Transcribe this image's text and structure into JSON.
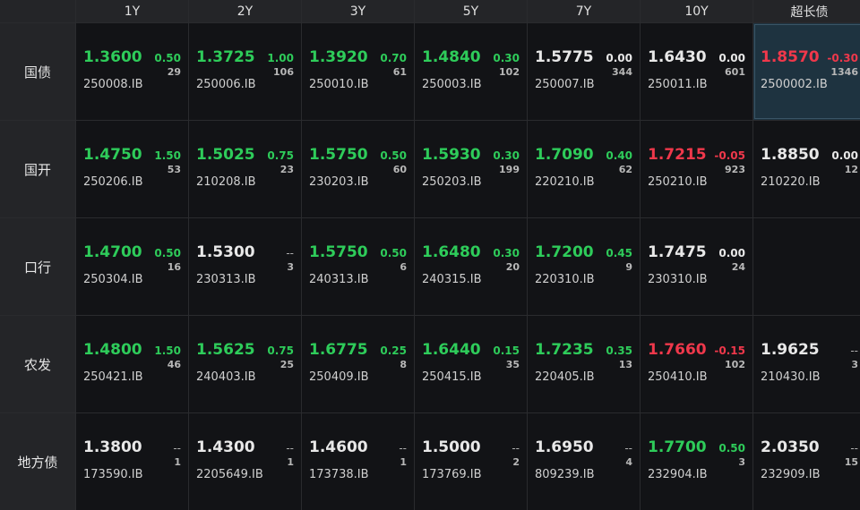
{
  "columns": [
    "1Y",
    "2Y",
    "3Y",
    "5Y",
    "7Y",
    "10Y",
    "超长债"
  ],
  "rows": [
    {
      "label": "国债",
      "cells": [
        {
          "yield": "1.3600",
          "change": "0.50",
          "volume": "29",
          "code": "250008.IB",
          "dir": "up"
        },
        {
          "yield": "1.3725",
          "change": "1.00",
          "volume": "106",
          "code": "250006.IB",
          "dir": "up"
        },
        {
          "yield": "1.3920",
          "change": "0.70",
          "volume": "61",
          "code": "250010.IB",
          "dir": "up"
        },
        {
          "yield": "1.4840",
          "change": "0.30",
          "volume": "102",
          "code": "250003.IB",
          "dir": "up"
        },
        {
          "yield": "1.5775",
          "change": "0.00",
          "volume": "344",
          "code": "250007.IB",
          "dir": "flat"
        },
        {
          "yield": "1.6430",
          "change": "0.00",
          "volume": "601",
          "code": "250011.IB",
          "dir": "flat"
        },
        {
          "yield": "1.8570",
          "change": "-0.30",
          "volume": "1346",
          "code": "2500002.IB",
          "dir": "down",
          "selected": true
        }
      ]
    },
    {
      "label": "国开",
      "cells": [
        {
          "yield": "1.4750",
          "change": "1.50",
          "volume": "53",
          "code": "250206.IB",
          "dir": "up"
        },
        {
          "yield": "1.5025",
          "change": "0.75",
          "volume": "23",
          "code": "210208.IB",
          "dir": "up"
        },
        {
          "yield": "1.5750",
          "change": "0.50",
          "volume": "60",
          "code": "230203.IB",
          "dir": "up"
        },
        {
          "yield": "1.5930",
          "change": "0.30",
          "volume": "199",
          "code": "250203.IB",
          "dir": "up"
        },
        {
          "yield": "1.7090",
          "change": "0.40",
          "volume": "62",
          "code": "220210.IB",
          "dir": "up"
        },
        {
          "yield": "1.7215",
          "change": "-0.05",
          "volume": "923",
          "code": "250210.IB",
          "dir": "down"
        },
        {
          "yield": "1.8850",
          "change": "0.00",
          "volume": "12",
          "code": "210220.IB",
          "dir": "flat"
        }
      ]
    },
    {
      "label": "口行",
      "cells": [
        {
          "yield": "1.4700",
          "change": "0.50",
          "volume": "16",
          "code": "250304.IB",
          "dir": "up"
        },
        {
          "yield": "1.5300",
          "change": "--",
          "volume": "3",
          "code": "230313.IB",
          "dir": "none"
        },
        {
          "yield": "1.5750",
          "change": "0.50",
          "volume": "6",
          "code": "240313.IB",
          "dir": "up"
        },
        {
          "yield": "1.6480",
          "change": "0.30",
          "volume": "20",
          "code": "240315.IB",
          "dir": "up"
        },
        {
          "yield": "1.7200",
          "change": "0.45",
          "volume": "9",
          "code": "220310.IB",
          "dir": "up"
        },
        {
          "yield": "1.7475",
          "change": "0.00",
          "volume": "24",
          "code": "230310.IB",
          "dir": "flat"
        },
        {
          "empty": true
        }
      ]
    },
    {
      "label": "农发",
      "cells": [
        {
          "yield": "1.4800",
          "change": "1.50",
          "volume": "46",
          "code": "250421.IB",
          "dir": "up"
        },
        {
          "yield": "1.5625",
          "change": "0.75",
          "volume": "25",
          "code": "240403.IB",
          "dir": "up"
        },
        {
          "yield": "1.6775",
          "change": "0.25",
          "volume": "8",
          "code": "250409.IB",
          "dir": "up"
        },
        {
          "yield": "1.6440",
          "change": "0.15",
          "volume": "35",
          "code": "250415.IB",
          "dir": "up"
        },
        {
          "yield": "1.7235",
          "change": "0.35",
          "volume": "13",
          "code": "220405.IB",
          "dir": "up"
        },
        {
          "yield": "1.7660",
          "change": "-0.15",
          "volume": "102",
          "code": "250410.IB",
          "dir": "down"
        },
        {
          "yield": "1.9625",
          "change": "--",
          "volume": "3",
          "code": "210430.IB",
          "dir": "none"
        }
      ]
    },
    {
      "label": "地方债",
      "cells": [
        {
          "yield": "1.3800",
          "change": "--",
          "volume": "1",
          "code": "173590.IB",
          "dir": "none"
        },
        {
          "yield": "1.4300",
          "change": "--",
          "volume": "1",
          "code": "2205649.IB",
          "dir": "none"
        },
        {
          "yield": "1.4600",
          "change": "--",
          "volume": "1",
          "code": "173738.IB",
          "dir": "none"
        },
        {
          "yield": "1.5000",
          "change": "--",
          "volume": "2",
          "code": "173769.IB",
          "dir": "none"
        },
        {
          "yield": "1.6950",
          "change": "--",
          "volume": "4",
          "code": "809239.IB",
          "dir": "none"
        },
        {
          "yield": "1.7700",
          "change": "0.50",
          "volume": "3",
          "code": "232904.IB",
          "dir": "up"
        },
        {
          "yield": "2.0350",
          "change": "--",
          "volume": "15",
          "code": "232909.IB",
          "dir": "none"
        }
      ]
    }
  ],
  "colors": {
    "up": "#2ecc5a",
    "down": "#f0384b",
    "flat": "#e8e8e8",
    "selected_bg": "#1e3340"
  }
}
